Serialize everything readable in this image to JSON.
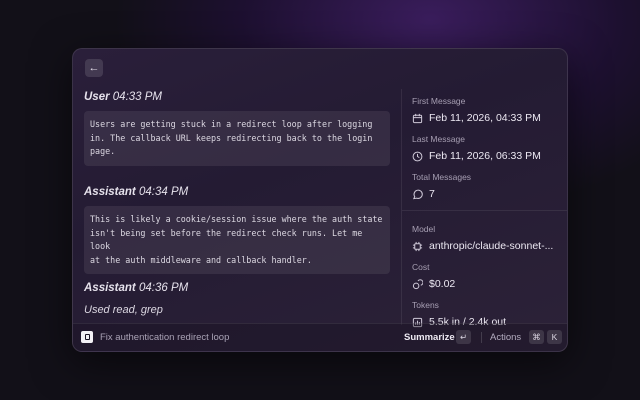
{
  "chat": {
    "messages": [
      {
        "role": "User",
        "time": "04:33 PM",
        "text": "Users are getting stuck in a redirect loop after logging\nin. The callback URL keeps redirecting back to the login\npage."
      },
      {
        "role": "Assistant",
        "time": "04:34 PM",
        "text": "This is likely a cookie/session issue where the auth state\nisn't being set before the redirect check runs. Let me look\nat the auth middleware and callback handler."
      },
      {
        "role": "Assistant",
        "time": "04:36 PM",
        "tools": "Used read, grep"
      }
    ]
  },
  "sidebar": {
    "first_message": {
      "label": "First Message",
      "value": "Feb 11, 2026, 04:33 PM",
      "icon": "calendar-icon"
    },
    "last_message": {
      "label": "Last Message",
      "value": "Feb 11, 2026, 06:33 PM",
      "icon": "clock-icon"
    },
    "total_messages": {
      "label": "Total Messages",
      "value": "7",
      "icon": "chat-bubble-icon"
    },
    "model": {
      "label": "Model",
      "value": "anthropic/claude-sonnet-...",
      "icon": "chip-icon"
    },
    "cost": {
      "label": "Cost",
      "value": "$0.02",
      "icon": "coins-icon"
    },
    "tokens": {
      "label": "Tokens",
      "value": "5.5k in / 2.4k out",
      "icon": "bar-chart-icon"
    }
  },
  "footer": {
    "title": "Fix authentication redirect loop",
    "summarize_label": "Summarize",
    "summarize_key": "↵",
    "actions_label": "Actions",
    "actions_keys": [
      "⌘",
      "K"
    ]
  },
  "icons": {
    "back": "←"
  }
}
